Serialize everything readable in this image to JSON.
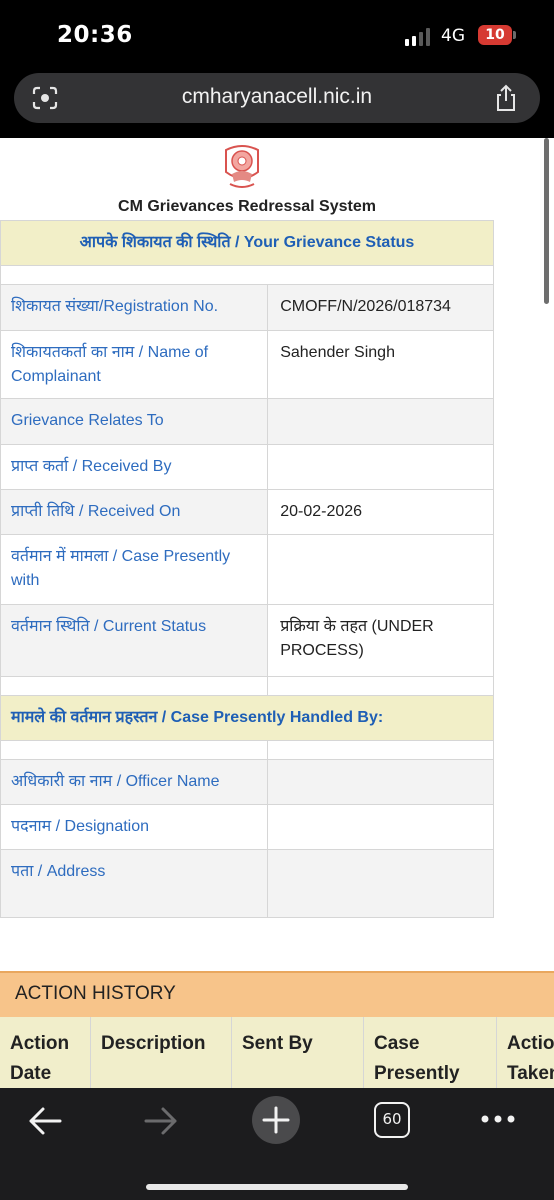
{
  "status_bar": {
    "time": "20:36",
    "network": "4G",
    "battery": "10"
  },
  "browser": {
    "url": "cmharyanacell.nic.in",
    "tab_count": "60"
  },
  "page": {
    "title": "CM Grievances Redressal System",
    "grievance_header": "आपके शिकायत की स्थिति / Your Grievance Status",
    "rows": [
      {
        "label": "शिकायत संख्या/Registration No.",
        "value": "CMOFF/N/2026/018734"
      },
      {
        "label": "शिकायतकर्ता का नाम / Name of Complainant",
        "value": "Sahender Singh"
      },
      {
        "label": "Grievance Relates To",
        "value": ""
      },
      {
        "label": "प्राप्त कर्ता / Received By",
        "value": ""
      },
      {
        "label": "प्राप्ती तिथि / Received On",
        "value": "20-02-2026"
      },
      {
        "label": "वर्तमान में मामला / Case Presently with",
        "value": ""
      },
      {
        "label": "वर्तमान स्थिति / Current Status",
        "value": "प्रक्रिया के तहत (UNDER PROCESS)"
      }
    ],
    "handled_header": "मामले की वर्तमान प्रहस्तन / Case Presently Handled By:",
    "officer_rows": [
      {
        "label": "अधिकारी का नाम / Officer Name",
        "value": ""
      },
      {
        "label": "पदनाम / Designation",
        "value": ""
      },
      {
        "label": "पता / Address",
        "value": ""
      }
    ],
    "action_history": {
      "title": "ACTION HISTORY",
      "columns": [
        "Action Date",
        "Description",
        "Sent By",
        "Case Presently",
        "Action Taken"
      ]
    }
  },
  "icons": {
    "lens": "google-lens-icon",
    "share": "share-icon",
    "back": "back-arrow-icon",
    "forward": "forward-arrow-icon",
    "new_tab": "plus-icon",
    "tabs": "tab-switcher-icon",
    "more": "more-dots-icon"
  }
}
